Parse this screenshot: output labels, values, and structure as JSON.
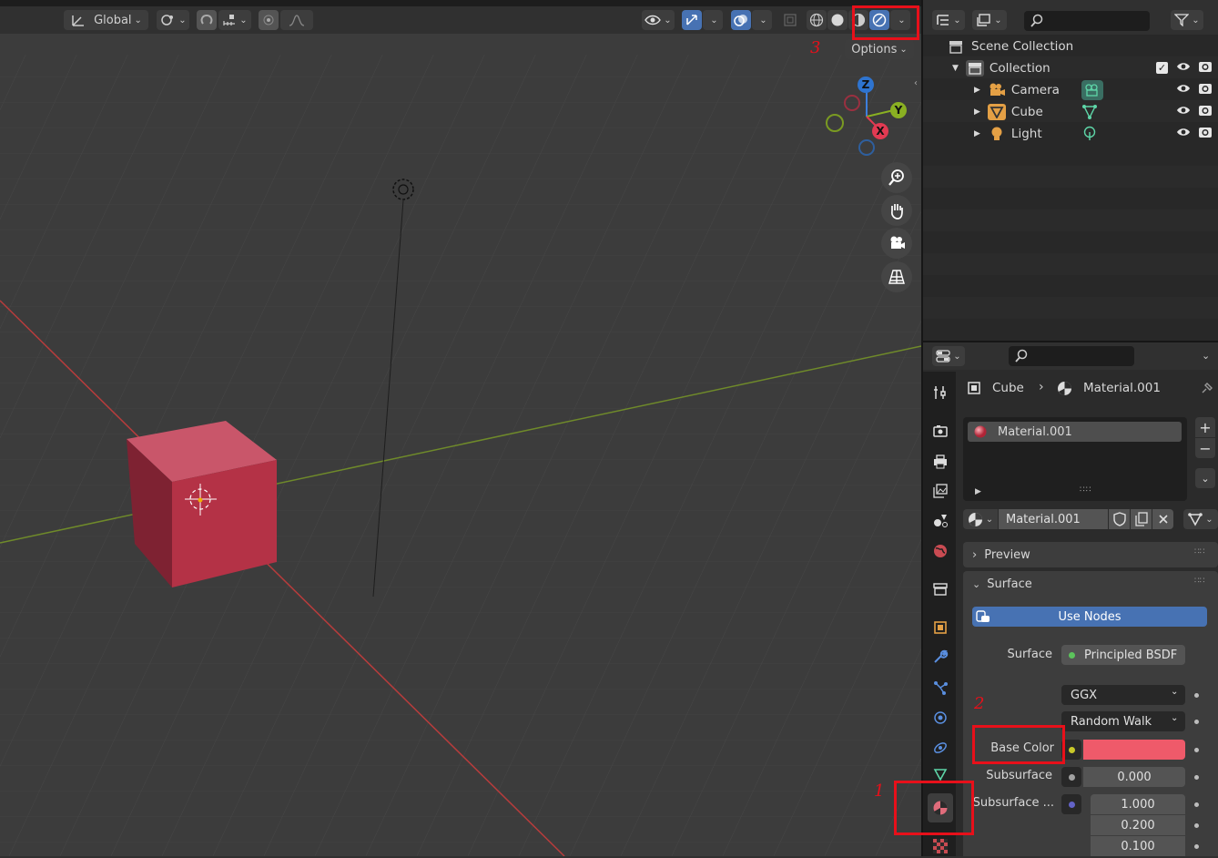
{
  "header": {
    "orientation_label": "Global",
    "options_label": "Options"
  },
  "gizmo": {
    "z": "Z",
    "y": "Y",
    "x": "X"
  },
  "outliner": {
    "root": "Scene Collection",
    "collection": "Collection",
    "items": [
      {
        "label": "Camera"
      },
      {
        "label": "Cube"
      },
      {
        "label": "Light"
      }
    ]
  },
  "properties": {
    "breadcrumb_object": "Cube",
    "breadcrumb_material": "Material.001",
    "slot_name": "Material.001",
    "material_name": "Material.001",
    "preview_label": "Preview",
    "surface_panel_label": "Surface",
    "use_nodes_label": "Use Nodes",
    "surface_label": "Surface",
    "surface_value": "Principled BSDF",
    "distribution_value": "GGX",
    "subsurface_method_value": "Random Walk",
    "base_color_label": "Base Color",
    "subsurface_label": "Subsurface",
    "subsurface_value": "0.000",
    "subsurface_radius_label": "Subsurface ...",
    "radius_values": [
      "1.000",
      "0.200",
      "0.100"
    ]
  },
  "annotations": {
    "one": "1",
    "two": "2",
    "three": "3"
  },
  "colors": {
    "base_color": "#ef5a6a",
    "cube_front": "#c23a4e",
    "accent": "#4772b3",
    "highlight": "#e8101a"
  }
}
